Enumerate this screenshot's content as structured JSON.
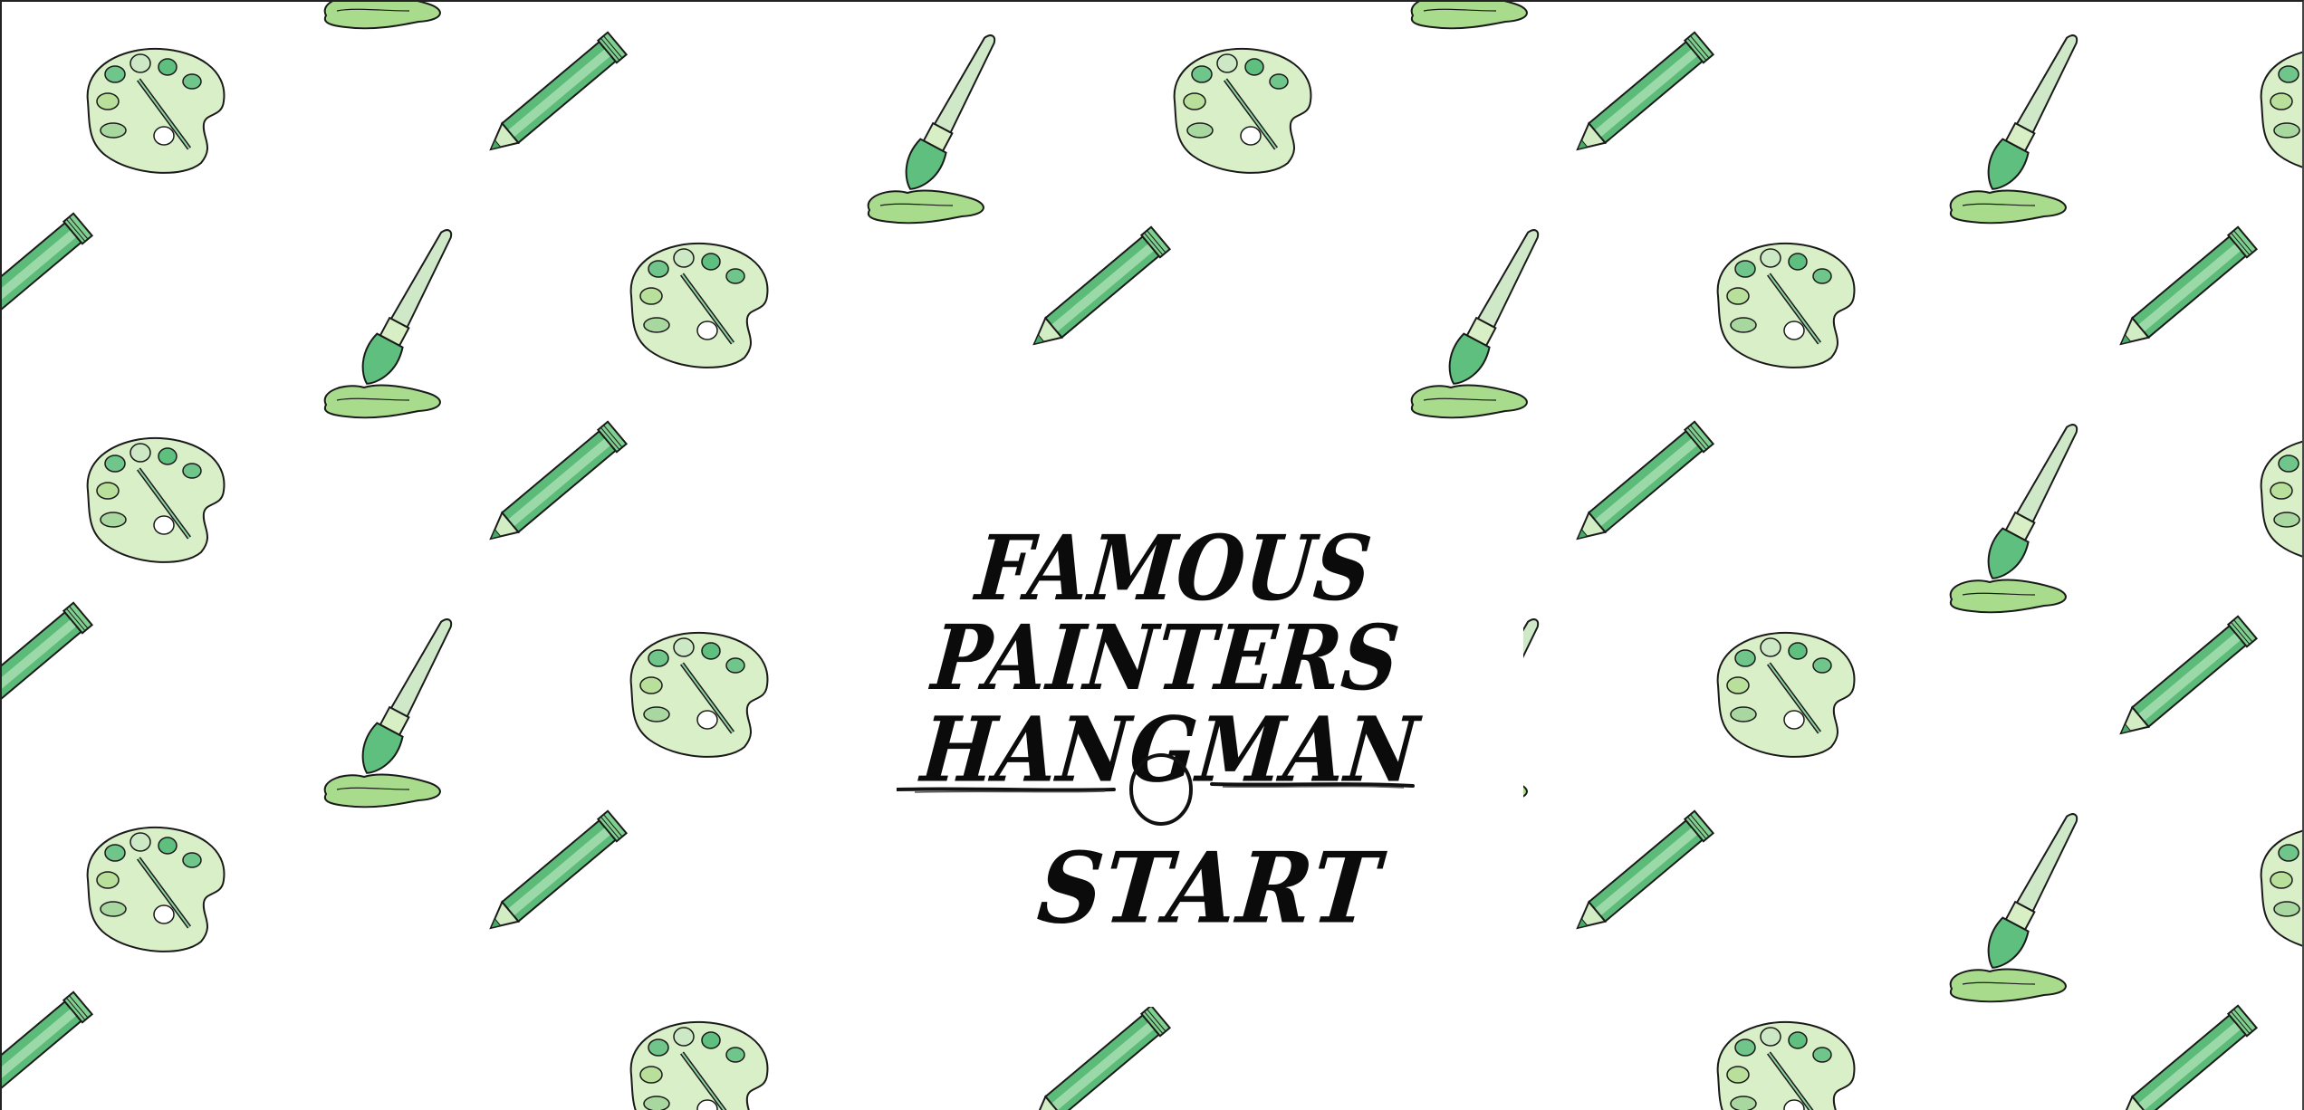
{
  "game": {
    "title_line1": "FAMOUS PAINTERS",
    "title_line2": "HANGMAN",
    "start_label": "START"
  },
  "background": {
    "pattern_icons": [
      "palette-icon",
      "pencil-icon",
      "paintbrush-icon"
    ],
    "colors": {
      "light_green": "#cfe9c0",
      "mid_green": "#7fcf8f",
      "dark_green": "#4aa868",
      "pale_green": "#dff0d4",
      "outline": "#1a1a1a"
    }
  }
}
